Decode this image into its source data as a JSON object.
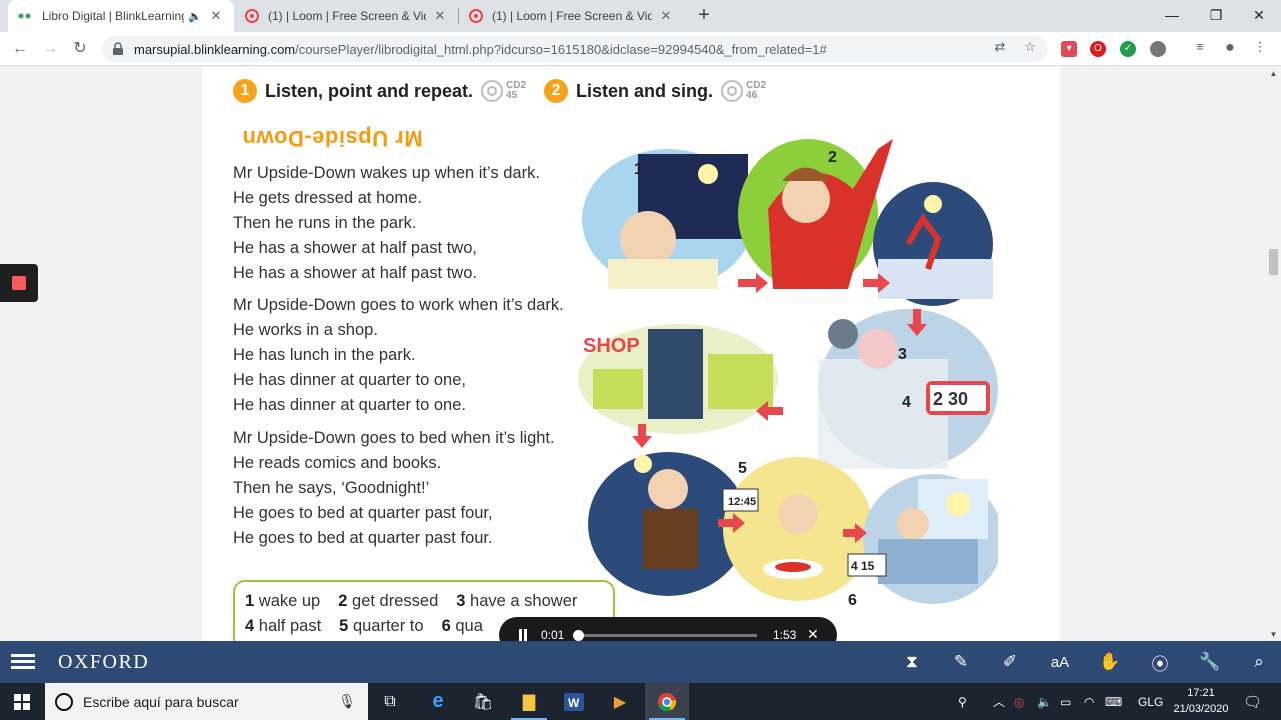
{
  "browser": {
    "tabs": [
      {
        "title": "Libro Digital | BlinkLearning",
        "active": true
      },
      {
        "title": "(1) | Loom | Free Screen & Video",
        "active": false
      },
      {
        "title": "(1) | Loom | Free Screen & Video",
        "active": false
      }
    ],
    "new_tab_label": "+",
    "url_host": "marsupial.blinklearning.com",
    "url_path": "/coursePlayer/librodigital_html.php?idcurso=1615180&idclase=92994540&_from_related=1#"
  },
  "book": {
    "activity1": {
      "number": "1",
      "title": "Listen, point and repeat.",
      "cd_label": "CD2",
      "cd_track": "45"
    },
    "activity2": {
      "number": "2",
      "title": "Listen and sing.",
      "cd_label": "CD2",
      "cd_track": "46"
    },
    "song_title": "Mr Upside-Down",
    "verses": [
      [
        "Mr Upside-Down wakes up when it’s dark.",
        "He gets dressed at home.",
        "Then he runs in the park.",
        "He has a shower at half past two,",
        "He has a shower at half past two."
      ],
      [
        "Mr Upside-Down goes to work when it’s dark.",
        "He works in a shop.",
        "He has lunch in the park.",
        "He has dinner at quarter to one,",
        "He has dinner at quarter to one."
      ],
      [
        "Mr Upside-Down goes to bed when it’s light.",
        "He reads comics and books.",
        "Then he says, ‘Goodnight!’",
        "He goes to bed at quarter past four,",
        "He goes to bed at quarter past four."
      ]
    ],
    "vocab": [
      [
        {
          "n": "1",
          "t": "wake up"
        },
        {
          "n": "2",
          "t": "get dressed"
        },
        {
          "n": "3",
          "t": "have a shower"
        }
      ],
      [
        {
          "n": "4",
          "t": "half past"
        },
        {
          "n": "5",
          "t": "quarter to"
        },
        {
          "n": "6",
          "t": "qua"
        }
      ]
    ],
    "illustration": {
      "panel_numbers": [
        "1",
        "2",
        "3",
        "4",
        "5",
        "6"
      ],
      "shop_sign": "SHOP",
      "clock_half_past": "2 30",
      "clock_quarter_to": "12:45",
      "clock_quarter_past": "4 15"
    }
  },
  "player": {
    "current": "0:01",
    "duration": "1:53",
    "progress": 0.006
  },
  "oxford": {
    "logo": "OXFORD",
    "font_tool_label": "aA"
  },
  "taskbar": {
    "search_placeholder": "Escribe aquí para buscar",
    "lang": "GLG",
    "time": "17:21",
    "date": "21/03/2020"
  },
  "colors": {
    "oxford_blue": "#2e4a74",
    "accent_orange": "#f7a21b",
    "vocab_green": "#9bc53d"
  }
}
